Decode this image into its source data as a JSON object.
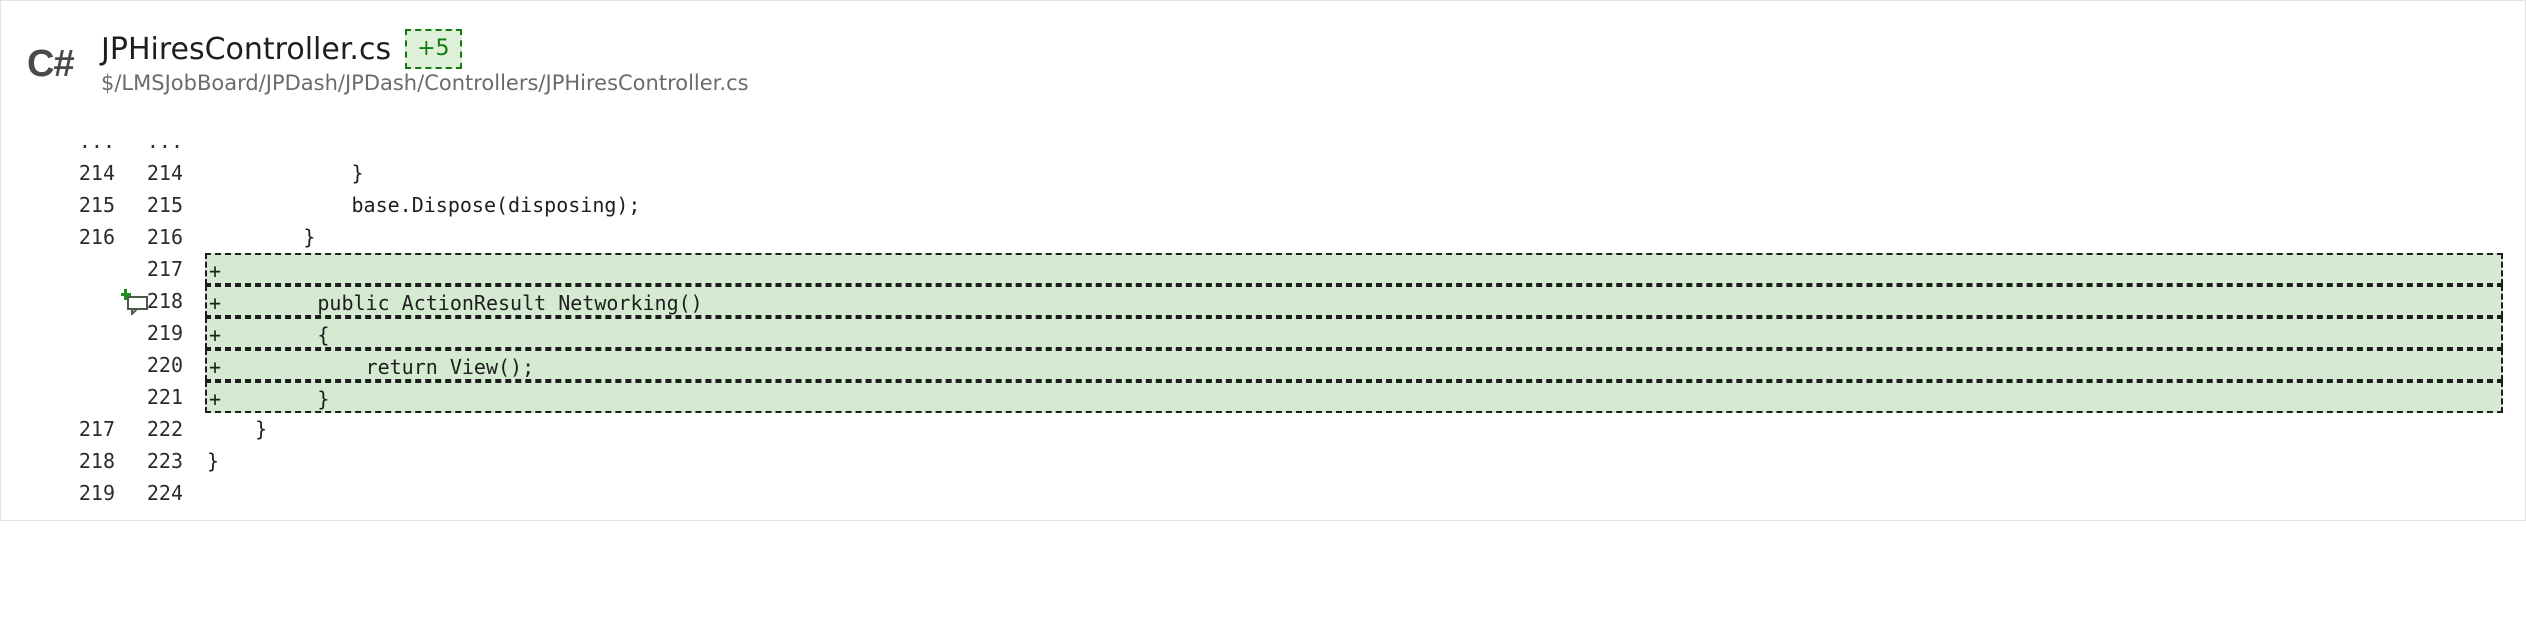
{
  "file": {
    "language_icon": "C#",
    "name": "JPHiresController.cs",
    "change_badge": "+5",
    "path": "$/LMSJobBoard/JPDash/JPDash/Controllers/JPHiresController.cs"
  },
  "colors": {
    "added_background": "#d4ead1",
    "badge_text": "#107c10",
    "badge_background": "#dff0d8"
  },
  "diff": {
    "rows": [
      {
        "type": "ellipsis",
        "old": "...",
        "new": "...",
        "marker": "",
        "code": ""
      },
      {
        "type": "context",
        "old": "214",
        "new": "214",
        "marker": "",
        "code": "            }"
      },
      {
        "type": "context",
        "old": "215",
        "new": "215",
        "marker": "",
        "code": "            base.Dispose(disposing);"
      },
      {
        "type": "context",
        "old": "216",
        "new": "216",
        "marker": "",
        "code": "        }"
      },
      {
        "type": "added",
        "old": "",
        "new": "217",
        "marker": "+",
        "code": "",
        "comment_icon": "add-comment-icon"
      },
      {
        "type": "added",
        "old": "",
        "new": "218",
        "marker": "+",
        "code": "        public ActionResult Networking()"
      },
      {
        "type": "added",
        "old": "",
        "new": "219",
        "marker": "+",
        "code": "        {"
      },
      {
        "type": "added",
        "old": "",
        "new": "220",
        "marker": "+",
        "code": "            return View();"
      },
      {
        "type": "added",
        "old": "",
        "new": "221",
        "marker": "+",
        "code": "        }"
      },
      {
        "type": "context",
        "old": "217",
        "new": "222",
        "marker": "",
        "code": "    }"
      },
      {
        "type": "context",
        "old": "218",
        "new": "223",
        "marker": "",
        "code": "}"
      },
      {
        "type": "context",
        "old": "219",
        "new": "224",
        "marker": "",
        "code": ""
      }
    ]
  }
}
